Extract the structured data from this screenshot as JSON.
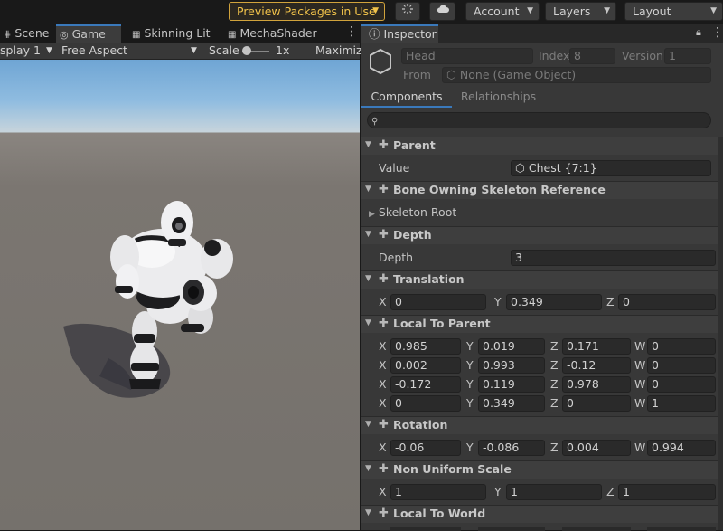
{
  "toolbar": {
    "preview_packages": "Preview Packages in Use",
    "account": "Account",
    "layers": "Layers",
    "layout": "Layout"
  },
  "left_tabs": [
    "Scene",
    "Game",
    "Skinning Lit",
    "MechaShader"
  ],
  "game_bar": {
    "display": "splay 1",
    "aspect": "Free Aspect",
    "scale_label": "Scale",
    "scale_value": "1x",
    "maximize": "Maximiz"
  },
  "inspector": {
    "tab": "Inspector",
    "entity_name": "Head",
    "index_label": "Index",
    "index_value": "8",
    "version_label": "Version",
    "version_value": "1",
    "from_label": "From",
    "from_value": "None (Game Object)",
    "subtabs": [
      "Components",
      "Relationships"
    ],
    "components": {
      "parent": {
        "title": "Parent",
        "value_label": "Value",
        "value": "Chest {7:1}"
      },
      "bone": {
        "title": "Bone Owning Skeleton Reference",
        "skeleton_root": "Skeleton Root"
      },
      "depth": {
        "title": "Depth",
        "label": "Depth",
        "value": "3"
      },
      "translation": {
        "title": "Translation",
        "x": "0",
        "y": "0.349",
        "z": "0"
      },
      "ltp": {
        "title": "Local To Parent",
        "rows": [
          {
            "x": "0.985",
            "y": "0.019",
            "z": "0.171",
            "w": "0"
          },
          {
            "x": "0.002",
            "y": "0.993",
            "z": "-0.12",
            "w": "0"
          },
          {
            "x": "-0.172",
            "y": "0.119",
            "z": "0.978",
            "w": "0"
          },
          {
            "x": "0",
            "y": "0.349",
            "z": "0",
            "w": "1"
          }
        ]
      },
      "rotation": {
        "title": "Rotation",
        "x": "-0.06",
        "y": "-0.086",
        "z": "0.004",
        "w": "0.994"
      },
      "nus": {
        "title": "Non Uniform Scale",
        "x": "1",
        "y": "1",
        "z": "1"
      },
      "ltw": {
        "title": "Local To World"
      }
    },
    "axis": {
      "x": "X",
      "y": "Y",
      "z": "Z",
      "w": "W"
    }
  }
}
